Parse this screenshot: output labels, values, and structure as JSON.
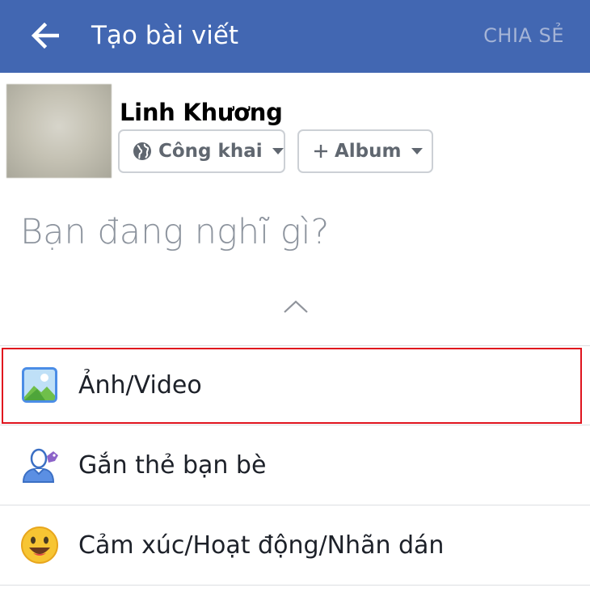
{
  "header": {
    "title": "Tạo bài viết",
    "share_label": "CHIA SẺ",
    "back_icon": "back-arrow-icon",
    "background": "#4267b2"
  },
  "composer": {
    "user_name": "Linh Khương",
    "privacy_label": "Công khai",
    "privacy_icon": "globe-icon",
    "album_label": "Album",
    "album_icon": "plus-icon",
    "placeholder": "Bạn đang nghĩ gì?"
  },
  "actions": [
    {
      "label": "Ảnh/Video",
      "icon": "photo-video-icon",
      "highlighted": true
    },
    {
      "label": "Gắn thẻ bạn bè",
      "icon": "tag-friends-icon"
    },
    {
      "label": "Cảm xúc/Hoạt động/Nhãn dán",
      "icon": "emoji-smile-icon"
    }
  ],
  "colors": {
    "accent": "#4267b2",
    "highlight_border": "#e0141e"
  }
}
